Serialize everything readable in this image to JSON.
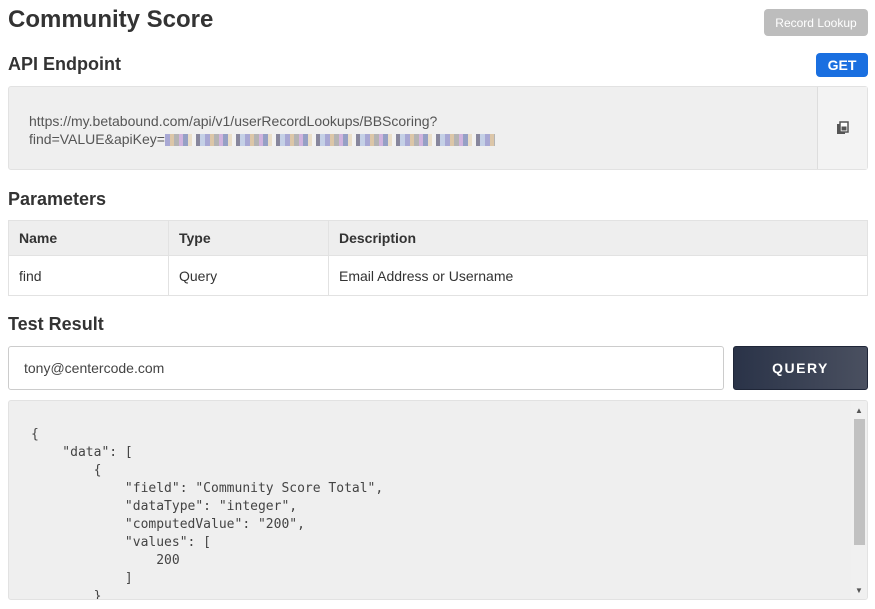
{
  "page": {
    "title": "Community Score",
    "record_lookup_label": "Record Lookup"
  },
  "endpoint": {
    "heading": "API Endpoint",
    "method": "GET",
    "url_line1": "https://my.betabound.com/api/v1/userRecordLookups/BBScoring?",
    "url_line2": "find=VALUE&apiKey=",
    "copy_icon": "copy-icon"
  },
  "parameters": {
    "heading": "Parameters",
    "columns": [
      "Name",
      "Type",
      "Description"
    ],
    "rows": [
      [
        "find",
        "Query",
        "Email Address or Username"
      ]
    ]
  },
  "test": {
    "heading": "Test Result",
    "input_value": "tony@centercode.com",
    "query_label": "QUERY",
    "result_json": "{\n    \"data\": [\n        {\n            \"field\": \"Community Score Total\",\n            \"dataType\": \"integer\",\n            \"computedValue\": \"200\",\n            \"values\": [\n                200\n            ]\n        }"
  },
  "colors": {
    "get_badge": "#1a6fe0",
    "query_button": "#2a3348",
    "record_button": "#bdbdbd"
  }
}
